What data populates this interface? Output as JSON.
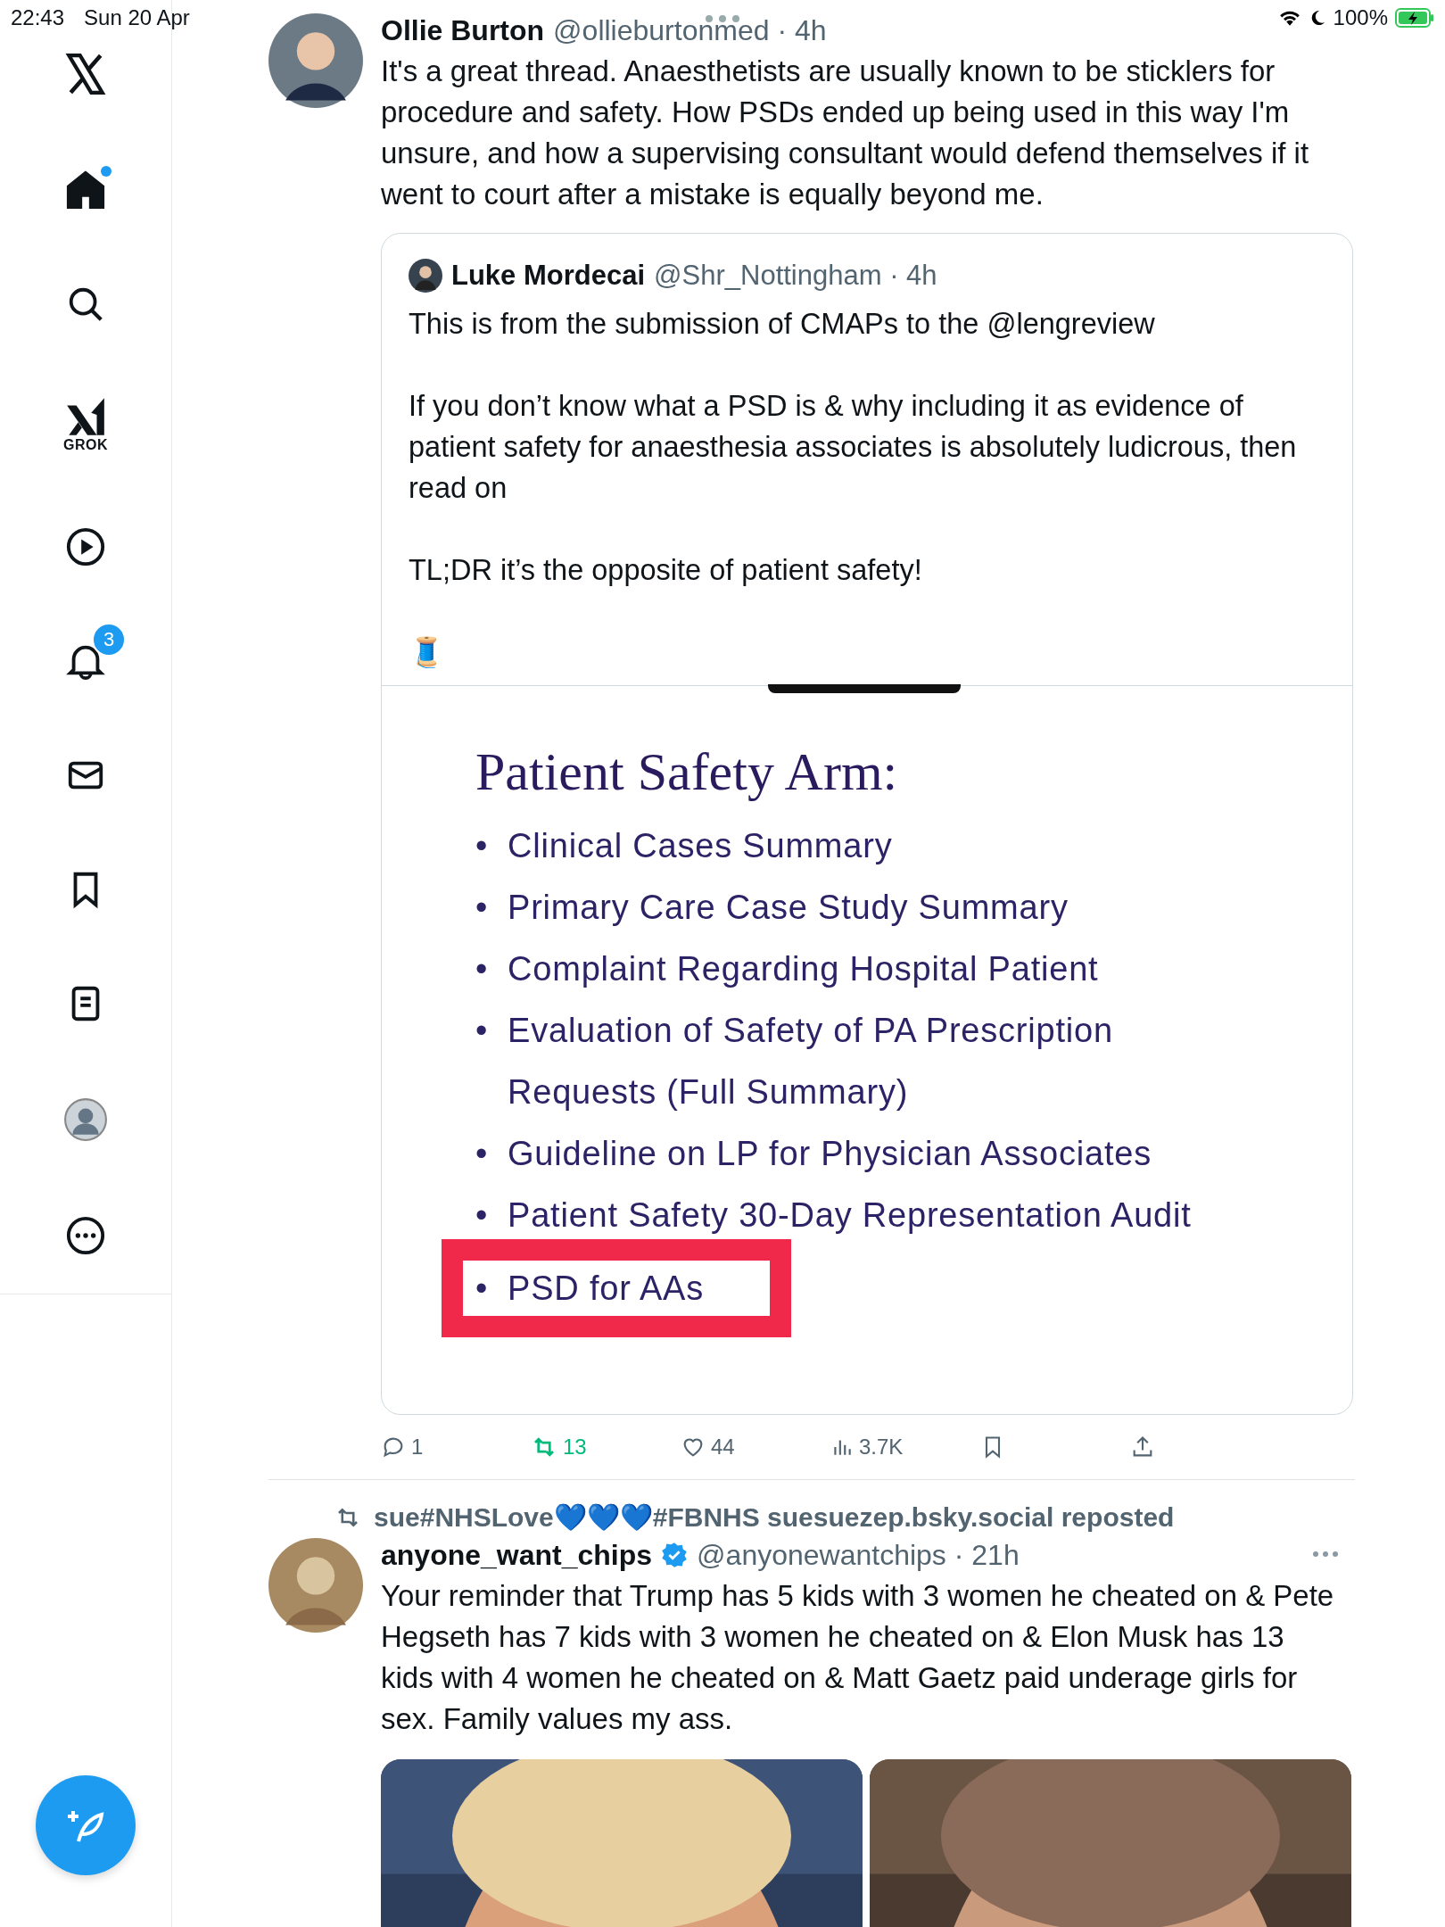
{
  "status_bar": {
    "time": "22:43",
    "date": "Sun 20 Apr",
    "battery": "100%"
  },
  "sidebar": {
    "items": [
      {
        "kind": "logo"
      },
      {
        "kind": "home",
        "dot": true
      },
      {
        "kind": "search"
      },
      {
        "kind": "grok",
        "label": "GROK"
      },
      {
        "kind": "video"
      },
      {
        "kind": "notifications",
        "badge": "3"
      },
      {
        "kind": "messages"
      },
      {
        "kind": "bookmarks"
      },
      {
        "kind": "lists"
      },
      {
        "kind": "profile"
      },
      {
        "kind": "more"
      }
    ]
  },
  "tweets": [
    {
      "author": "Ollie Burton",
      "meta": "@ollieburtonmed · 4h",
      "text": "It's a great thread. Anaesthetists are usually known to be sticklers for procedure and safety. How PSDs ended up being used in this way I'm unsure, and how a supervising consultant would defend themselves if it went to court after a mistake is equally beyond me.",
      "quote": {
        "author": "Luke Mordecai",
        "meta": "@Shr_Nottingham · 4h",
        "paragraphs": [
          "This is from the submission of CMAPs to the @lengreview",
          "If you don’t know what a PSD is & why including it as evidence of patient safety for anaesthesia associates is absolutely ludicrous, then read on",
          "TL;DR  it’s the opposite of patient safety!",
          "🧵"
        ],
        "slide": {
          "title": "Patient Safety Arm:",
          "items": [
            {
              "bullet": "•",
              "text": "Clinical Cases Summary",
              "highlighted": false
            },
            {
              "bullet": "•",
              "text": "Primary Care Case Study Summary",
              "highlighted": false
            },
            {
              "bullet": "•",
              "text": "Complaint Regarding Hospital Patient",
              "highlighted": false
            },
            {
              "bullet": "•",
              "text": "Evaluation of Safety of PA Prescription Requests (Full Summary)",
              "highlighted": false
            },
            {
              "bullet": "•",
              "text": "Guideline on LP for Physician Associates",
              "highlighted": false
            },
            {
              "bullet": "•",
              "text": "Patient Safety 30-Day Representation Audit",
              "highlighted": false
            },
            {
              "bullet": "•",
              "text": "PSD for AAs",
              "highlighted": true
            }
          ]
        }
      },
      "actions": [
        {
          "kind": "reply",
          "count": "1",
          "active": false
        },
        {
          "kind": "repost",
          "count": "13",
          "active": true
        },
        {
          "kind": "like",
          "count": "44",
          "active": false
        },
        {
          "kind": "views",
          "count": "3.7K",
          "active": false
        },
        {
          "kind": "bookmark",
          "active": false
        },
        {
          "kind": "share",
          "active": false
        }
      ]
    },
    {
      "repost_by": "sue#NHSLove💙💙💙#FBNHS suesuezep.bsky.social reposted",
      "author": "anyone_want_chips",
      "meta": "@anyonewantchips · 21h",
      "verified": true,
      "text": "Your reminder that Trump has 5 kids with 3 women he cheated on & Pete Hegseth has 7 kids with 3 women he cheated on & Elon Musk has 13 kids with 4 women he cheated on & Matt Gaetz paid underage girls for sex. Family values my ass."
    }
  ]
}
